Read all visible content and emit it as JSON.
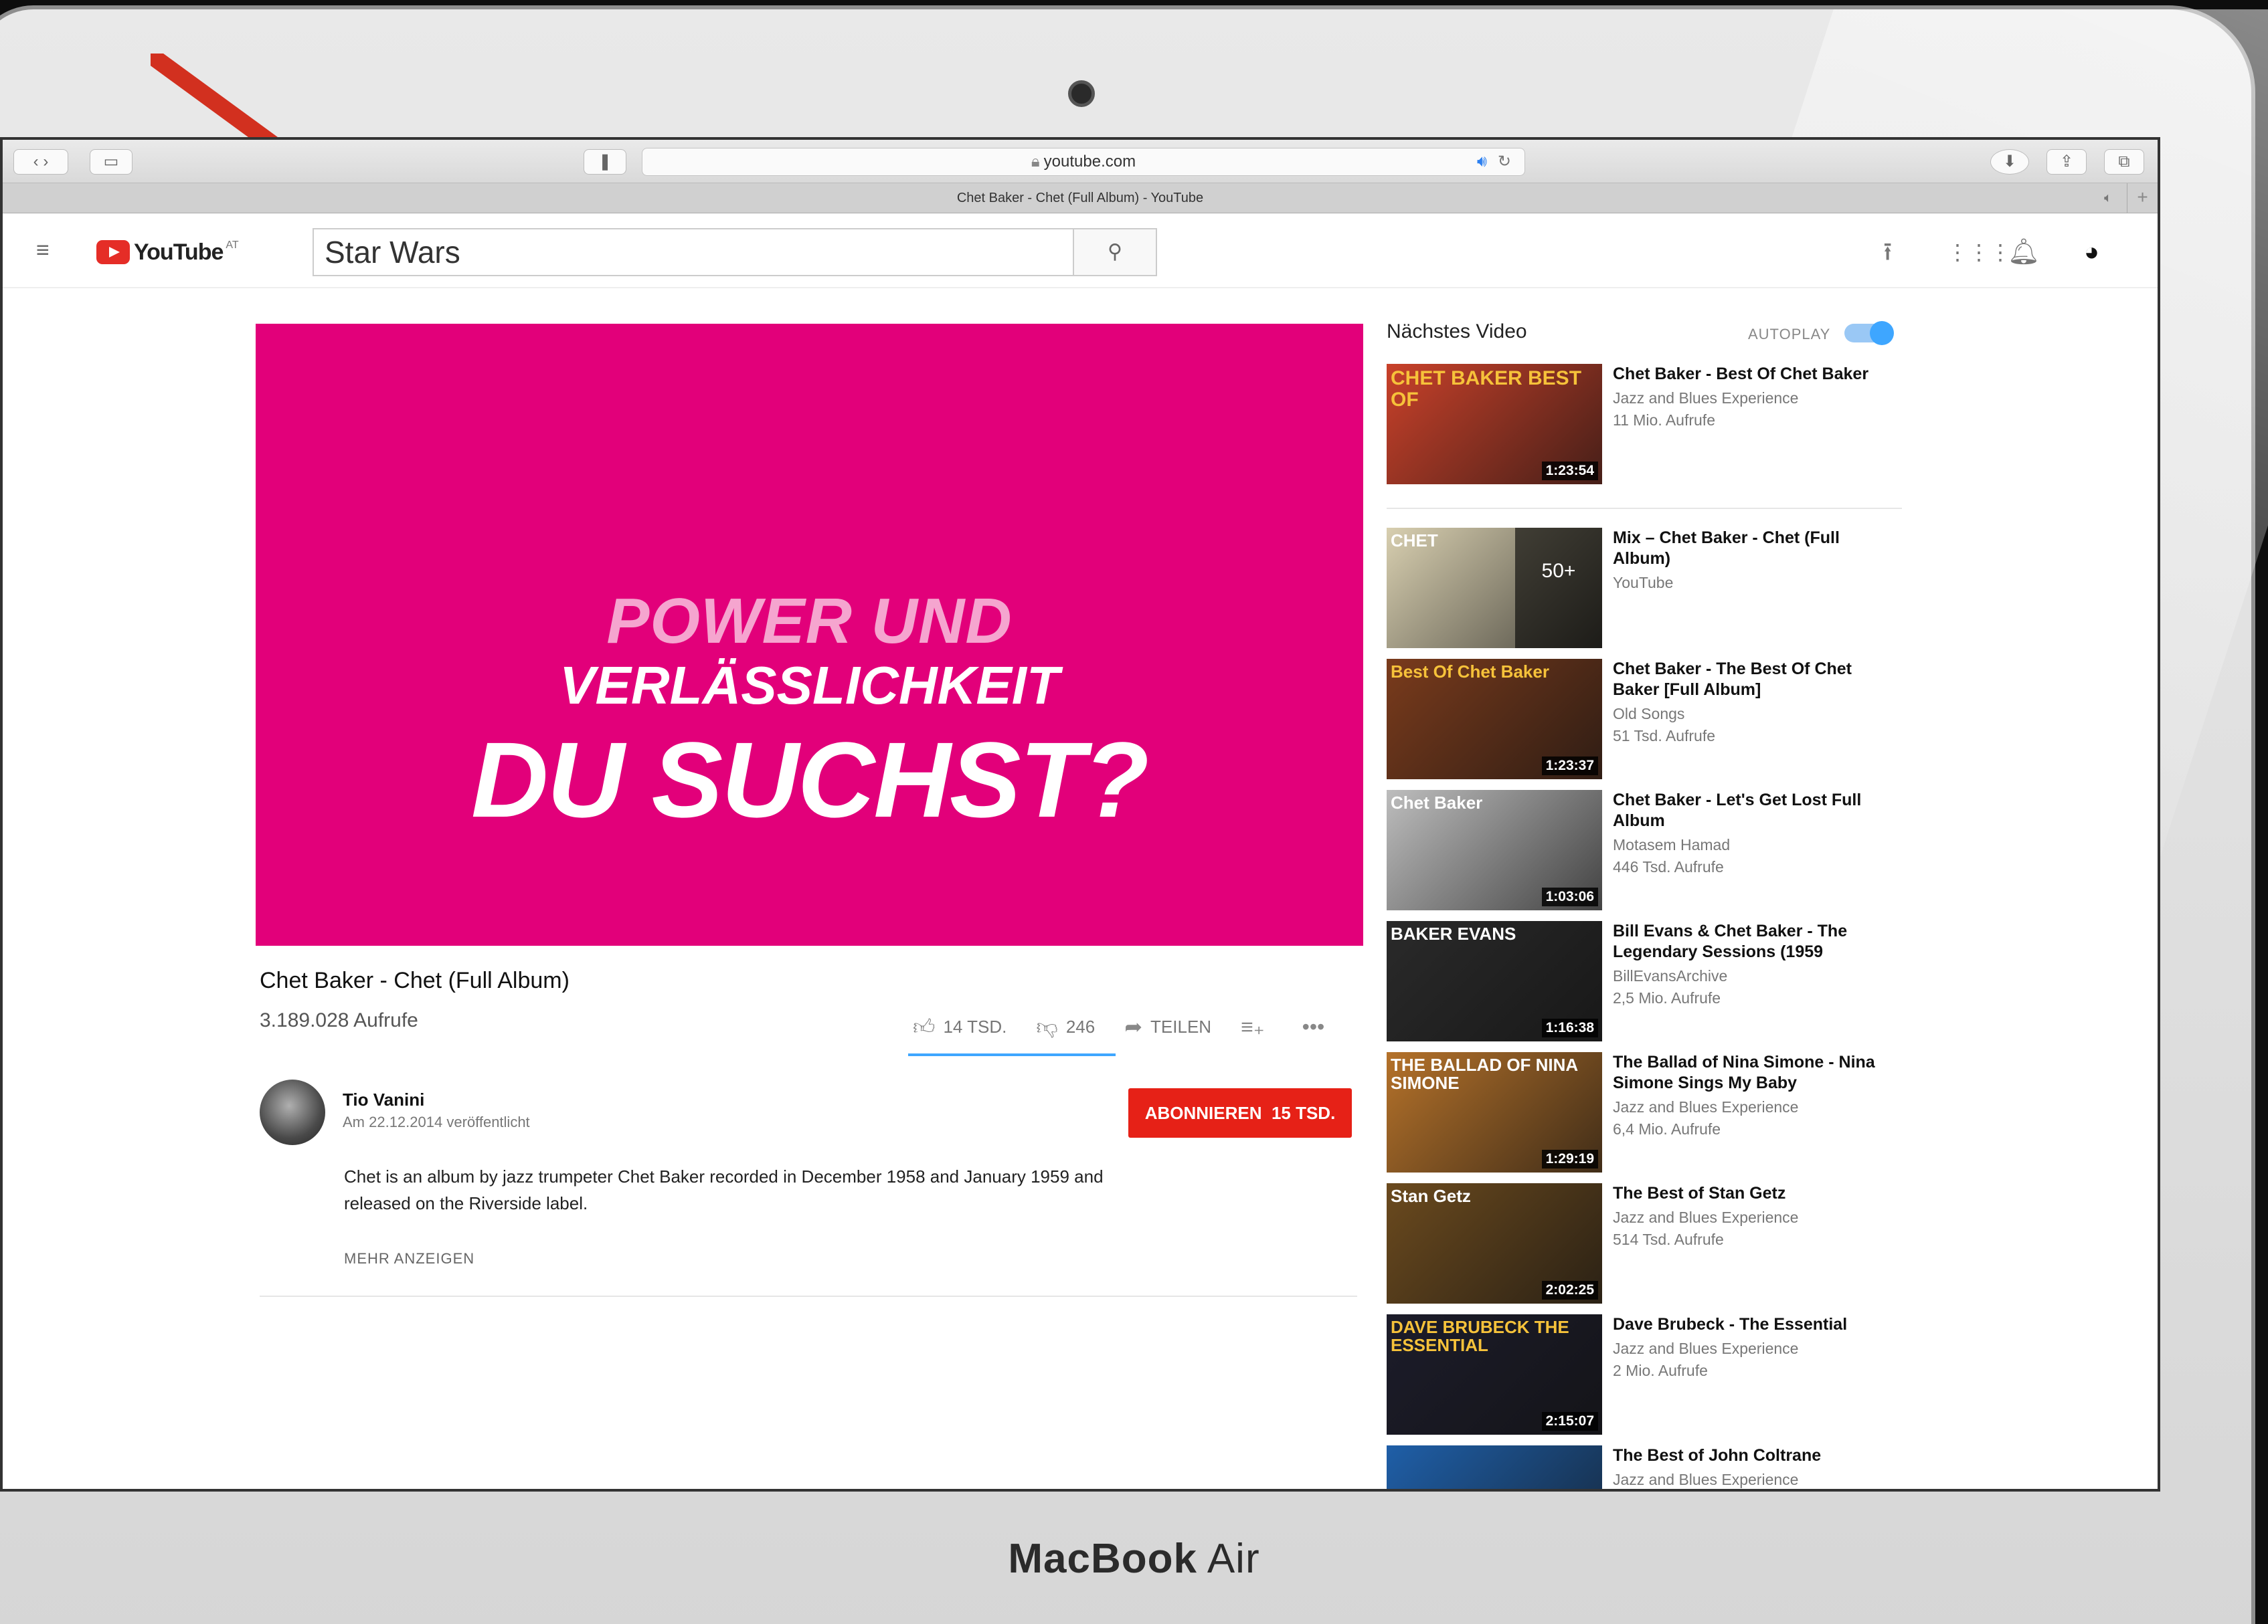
{
  "device": {
    "brand_bold": "MacBook",
    "brand_light": "Air"
  },
  "browser": {
    "url": "youtube.com",
    "tab_title": "Chet Baker - Chet (Full Album) - YouTube"
  },
  "youtube": {
    "logo_text": "YouTube",
    "country": "AT",
    "search_value": "Star Wars"
  },
  "ad": {
    "line1": "POWER UND",
    "line2": "VERLÄSSLICHKEIT",
    "line3": "DU SUCHST?"
  },
  "video": {
    "title": "Chet Baker - Chet (Full Album)",
    "views": "3.189.028 Aufrufe",
    "likes": "14 TSD.",
    "dislikes": "246",
    "share": "TEILEN",
    "channel": "Tio Vanini",
    "published": "Am 22.12.2014 veröffentlicht",
    "subscribe_label": "ABONNIEREN",
    "subscribers": "15 TSD.",
    "description": "Chet is an album by jazz trumpeter Chet Baker recorded in December 1958 and January 1959 and released on the Riverside label.",
    "more": "MEHR ANZEIGEN"
  },
  "sidebar": {
    "next_label": "Nächstes Video",
    "autoplay_label": "AUTOPLAY",
    "autoplay_on": true,
    "items": [
      {
        "title": "Chet Baker - Best Of Chet Baker",
        "channel": "Jazz and Blues Experience",
        "views": "11 Mio. Aufrufe",
        "duration": "1:23:54",
        "thumb_text": "CHET BAKER BEST OF",
        "thumb_color": "#c9412a"
      },
      {
        "title": "Mix – Chet Baker - Chet (Full Album)",
        "channel": "YouTube",
        "views": "",
        "duration": "",
        "playlist": "50+",
        "thumb_text": "CHET",
        "thumb_color": "#d8cfb0"
      },
      {
        "title": "Chet Baker - The Best Of Chet Baker [Full Album]",
        "channel": "Old Songs",
        "views": "51 Tsd. Aufrufe",
        "duration": "1:23:37",
        "thumb_text": "Best Of Chet Baker",
        "thumb_color": "#7a3b1c"
      },
      {
        "title": "Chet Baker - Let's Get Lost Full Album",
        "channel": "Motasem Hamad",
        "views": "446 Tsd. Aufrufe",
        "duration": "1:03:06",
        "thumb_text": "Chet Baker",
        "thumb_color": "#bdbdbd"
      },
      {
        "title": "Bill Evans & Chet Baker - The Legendary Sessions (1959",
        "channel": "BillEvansArchive",
        "views": "2,5 Mio. Aufrufe",
        "duration": "1:16:38",
        "thumb_text": "BAKER EVANS",
        "thumb_color": "#2a2a2a"
      },
      {
        "title": "The Ballad of Nina Simone - Nina Simone Sings My Baby",
        "channel": "Jazz and Blues Experience",
        "views": "6,4 Mio. Aufrufe",
        "duration": "1:29:19",
        "thumb_text": "THE BALLAD OF NINA SIMONE",
        "thumb_color": "#b5722a"
      },
      {
        "title": "The Best of Stan Getz",
        "channel": "Jazz and Blues Experience",
        "views": "514 Tsd. Aufrufe",
        "duration": "2:02:25",
        "thumb_text": "Stan Getz",
        "thumb_color": "#6b4a1e"
      },
      {
        "title": "Dave Brubeck - The Essential",
        "channel": "Jazz and Blues Experience",
        "views": "2 Mio. Aufrufe",
        "duration": "2:15:07",
        "thumb_text": "DAVE BRUBECK THE ESSENTIAL",
        "thumb_color": "#1c1c2a"
      },
      {
        "title": "The Best of John Coltrane",
        "channel": "Jazz and Blues Experience",
        "views": "",
        "duration": "",
        "thumb_text": "",
        "thumb_color": "#1f5fa8"
      }
    ]
  },
  "colors": {
    "accent": "#3ea6ff",
    "subscribe": "#e62117",
    "ad_bg": "#e2007a",
    "annotation_arrow": "#d2301f"
  }
}
